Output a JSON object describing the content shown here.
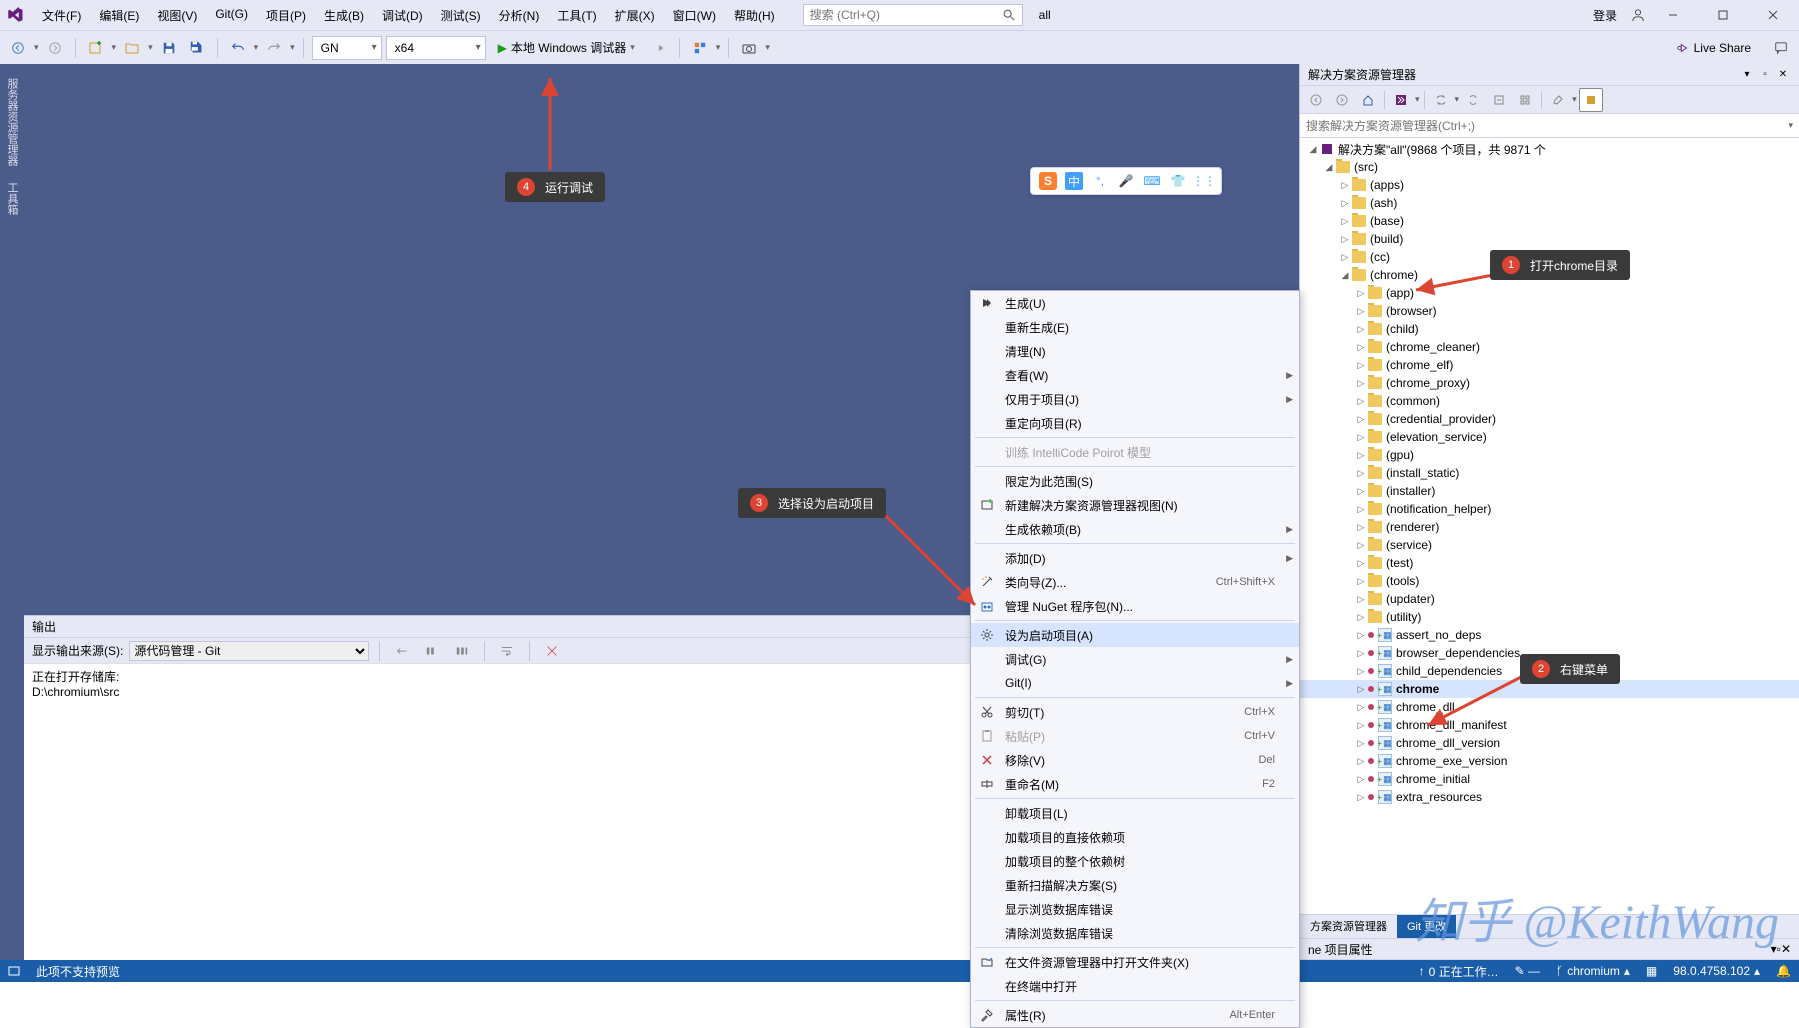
{
  "menu": [
    "文件(F)",
    "编辑(E)",
    "视图(V)",
    "Git(G)",
    "项目(P)",
    "生成(B)",
    "调试(D)",
    "测试(S)",
    "分析(N)",
    "工具(T)",
    "扩展(X)",
    "窗口(W)",
    "帮助(H)"
  ],
  "search": {
    "placeholder": "搜索 (Ctrl+Q)"
  },
  "all_label": "all",
  "login": "登录",
  "live_share": "Live Share",
  "toolbar": {
    "config": "GN",
    "platform": "x64",
    "run_label": "本地 Windows 调试器"
  },
  "left_tabs": [
    "服务器资源管理器",
    "工具箱"
  ],
  "output": {
    "title": "输出",
    "source_label": "显示输出来源(S):",
    "source_value": "源代码管理 - Git",
    "line1": "正在打开存储库:",
    "line2": "D:\\chromium\\src"
  },
  "sol": {
    "title": "解决方案资源管理器",
    "search_placeholder": "搜索解决方案资源管理器(Ctrl+;)",
    "root": "解决方案\"all\"(9868 个项目，共 9871 个",
    "src": "(src)",
    "folders_top": [
      "(apps)",
      "(ash)",
      "(base)",
      "(build)",
      "(cc)"
    ],
    "chrome": "(chrome)",
    "folders_chrome": [
      "(app)",
      "(browser)",
      "(child)",
      "(chrome_cleaner)",
      "(chrome_elf)",
      "(chrome_proxy)",
      "(common)",
      "(credential_provider)",
      "(elevation_service)",
      "(gpu)",
      "(install_static)",
      "(installer)",
      "(notification_helper)",
      "(renderer)",
      "(service)",
      "(test)",
      "(tools)",
      "(updater)",
      "(utility)"
    ],
    "projects": [
      "assert_no_deps",
      "browser_dependencies",
      "child_dependencies",
      "chrome",
      "chrome_dll",
      "chrome_dll_manifest",
      "chrome_dll_version",
      "chrome_exe_version",
      "chrome_initial",
      "extra_resources"
    ],
    "selected_project": "chrome",
    "tab1": "方案资源管理器",
    "tab2": "Git 更改",
    "props": "ne  项目属性"
  },
  "context_menu": [
    {
      "label": "生成(U)",
      "icon": "build"
    },
    {
      "label": "重新生成(E)"
    },
    {
      "label": "清理(N)"
    },
    {
      "label": "查看(W)",
      "sub": true
    },
    {
      "label": "仅用于项目(J)",
      "sub": true
    },
    {
      "label": "重定向项目(R)"
    },
    {
      "sep": true
    },
    {
      "label": "训练 IntelliCode Poirot 模型",
      "disabled": true
    },
    {
      "sep": true
    },
    {
      "label": "限定为此范围(S)"
    },
    {
      "label": "新建解决方案资源管理器视图(N)",
      "icon": "newview"
    },
    {
      "label": "生成依赖项(B)",
      "sub": true
    },
    {
      "sep": true
    },
    {
      "label": "添加(D)",
      "sub": true
    },
    {
      "label": "类向导(Z)...",
      "icon": "wizard",
      "shortcut": "Ctrl+Shift+X"
    },
    {
      "label": "管理 NuGet 程序包(N)...",
      "icon": "nuget"
    },
    {
      "sep": true
    },
    {
      "label": "设为启动项目(A)",
      "icon": "gear",
      "selected": true
    },
    {
      "label": "调试(G)",
      "sub": true
    },
    {
      "label": "Git(I)",
      "sub": true
    },
    {
      "sep": true
    },
    {
      "label": "剪切(T)",
      "icon": "cut",
      "shortcut": "Ctrl+X"
    },
    {
      "label": "粘贴(P)",
      "icon": "paste",
      "shortcut": "Ctrl+V",
      "disabled": true
    },
    {
      "label": "移除(V)",
      "icon": "remove",
      "shortcut": "Del"
    },
    {
      "label": "重命名(M)",
      "icon": "rename",
      "shortcut": "F2"
    },
    {
      "sep": true
    },
    {
      "label": "卸载项目(L)"
    },
    {
      "label": "加载项目的直接依赖项"
    },
    {
      "label": "加载项目的整个依赖树"
    },
    {
      "label": "重新扫描解决方案(S)"
    },
    {
      "label": "显示浏览数据库错误"
    },
    {
      "label": "清除浏览数据库错误"
    },
    {
      "sep": true
    },
    {
      "label": "在文件资源管理器中打开文件夹(X)",
      "icon": "folder"
    },
    {
      "label": "在终端中打开"
    },
    {
      "sep": true
    },
    {
      "label": "属性(R)",
      "icon": "props",
      "shortcut": "Alt+Enter"
    }
  ],
  "annot": {
    "a1": "打开chrome目录",
    "a2": "右键菜单",
    "a3": "选择设为启动项目",
    "a4": "运行调试"
  },
  "ime": [
    "中"
  ],
  "status": {
    "msg": "此项不支持预览",
    "work": "0  正在工作…",
    "branch": "chromium",
    "version": "98.0.4758.102"
  },
  "watermark": "知乎 @KeithWang"
}
